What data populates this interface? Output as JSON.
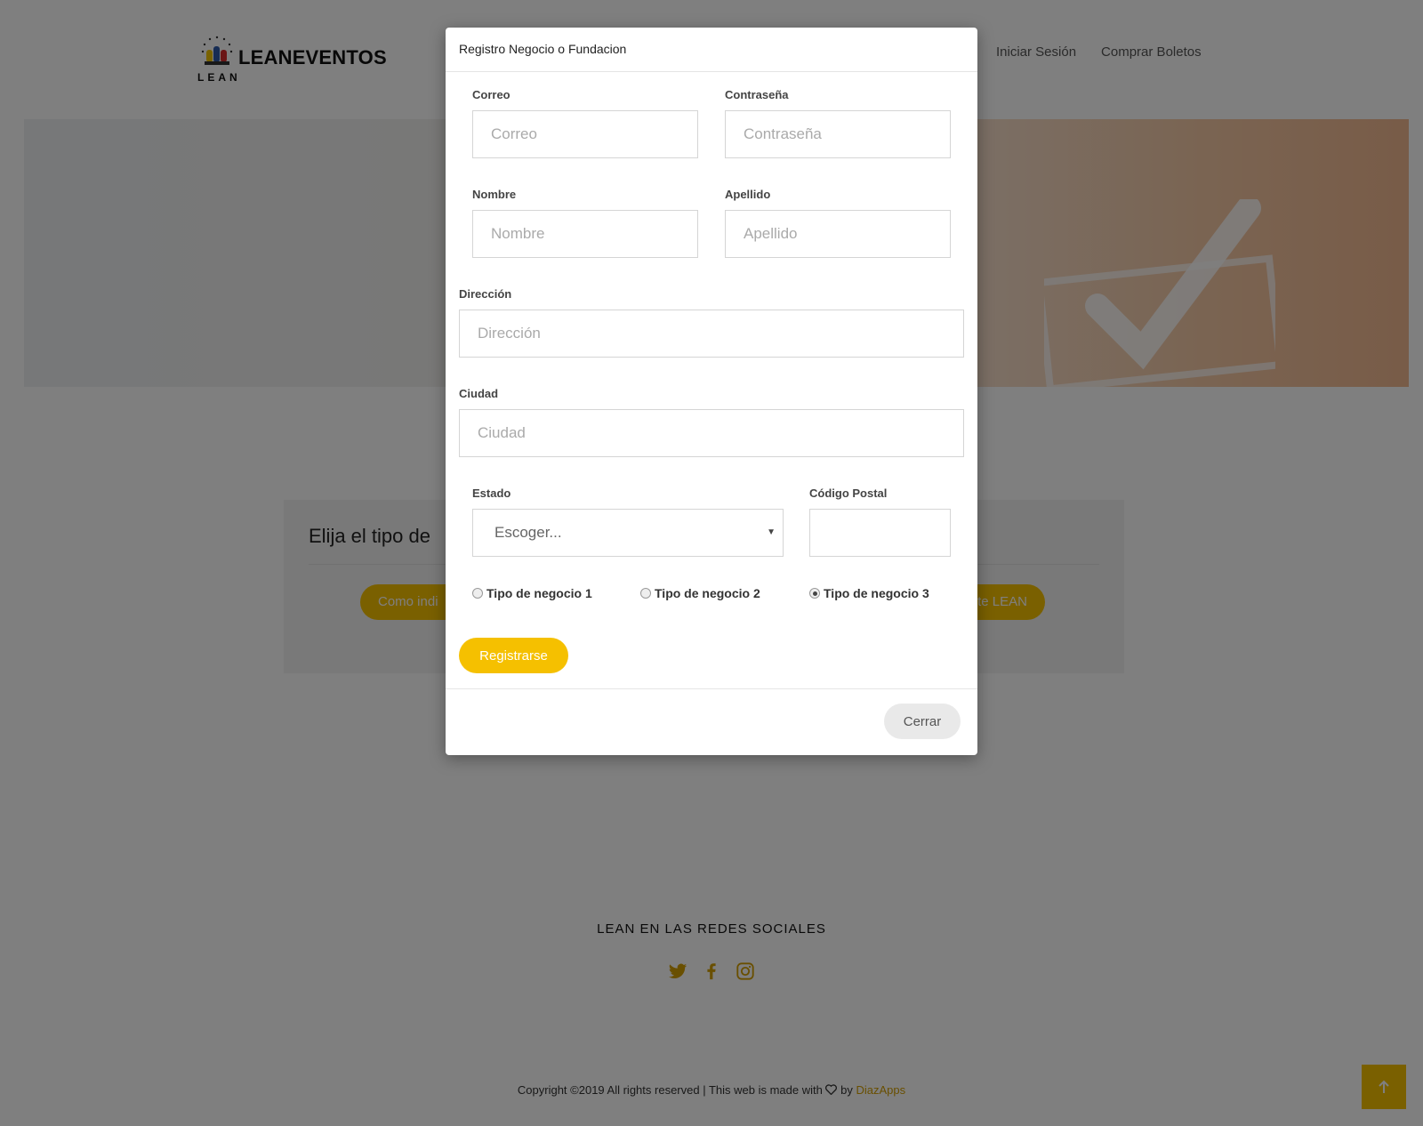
{
  "nav": {
    "logo_text": "LEANEVENTOS",
    "logo_sub": "LEAN",
    "links": [
      "Iniciar Sesión",
      "Comprar Boletos"
    ]
  },
  "choose": {
    "title": "Elija el tipo de",
    "left_button": "Como indi",
    "right_button": "nte LEAN"
  },
  "modal": {
    "title": "Registro Negocio o Fundacion",
    "fields": {
      "correo": {
        "label": "Correo",
        "placeholder": "Correo"
      },
      "contrasena": {
        "label": "Contraseña",
        "placeholder": "Contraseña"
      },
      "nombre": {
        "label": "Nombre",
        "placeholder": "Nombre"
      },
      "apellido": {
        "label": "Apellido",
        "placeholder": "Apellido"
      },
      "direccion": {
        "label": "Dirección",
        "placeholder": "Dirección"
      },
      "ciudad": {
        "label": "Ciudad",
        "placeholder": "Ciudad"
      },
      "estado": {
        "label": "Estado",
        "value": "Escoger..."
      },
      "codigo_postal": {
        "label": "Código Postal",
        "placeholder": ""
      }
    },
    "radios": [
      {
        "label": "Tipo de negocio 1",
        "checked": false
      },
      {
        "label": "Tipo de negocio 2",
        "checked": false
      },
      {
        "label": "Tipo de negocio 3",
        "checked": true
      }
    ],
    "register_label": "Registrarse",
    "close_label": "Cerrar"
  },
  "social": {
    "title": "LEAN EN LAS REDES SOCIALES",
    "icons": [
      "twitter-icon",
      "facebook-icon",
      "instagram-icon"
    ]
  },
  "footer": {
    "text": "Copyright ©2019 All rights reserved | This web is made with",
    "by": "by",
    "brand": "DiazApps"
  },
  "colors": {
    "accent": "#f5c000",
    "brand_link": "#d39e00"
  }
}
